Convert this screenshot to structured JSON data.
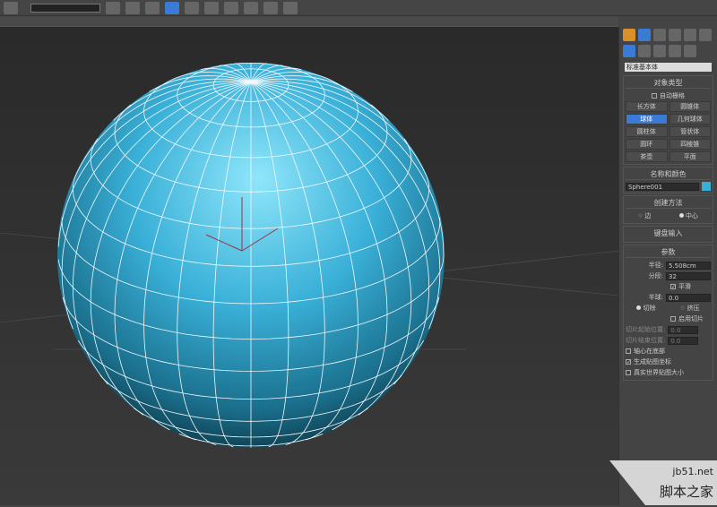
{
  "toolbar": {
    "icon_count": 12
  },
  "panel": {
    "category_dropdown": "标准基本体",
    "object_type": {
      "title": "对象类型",
      "autogrid": "自动栅格",
      "buttons": [
        "长方体",
        "圆锥体",
        "球体",
        "几何球体",
        "圆柱体",
        "管状体",
        "圆环",
        "四棱锥",
        "茶壶",
        "平面"
      ],
      "active": "球体"
    },
    "name_color": {
      "title": "名称和颜色",
      "name": "Sphere001",
      "color": "#3ab0d8"
    },
    "creation_method": {
      "title": "创建方法",
      "edge": "边",
      "center": "中心"
    },
    "keyboard_entry": "键盘输入",
    "parameters": {
      "title": "参数",
      "radius_label": "半径:",
      "radius": "5.508cm",
      "segments_label": "分段:",
      "segments": "32",
      "smooth": "平滑",
      "hemisphere_label": "半球:",
      "hemisphere": "0.0",
      "chop": "切除",
      "squash": "挤压",
      "slice_on": "启用切片",
      "slice_from": "切片起始位置:",
      "slice_to": "切片结束位置:",
      "slice_from_val": "0.0",
      "slice_to_val": "0.0",
      "base_to_pivot": "轴心在底部",
      "gen_map": "生成贴图坐标",
      "real_world": "真实世界贴图大小"
    }
  },
  "watermark": {
    "site": "jb51.net",
    "name": "脚本之家"
  }
}
